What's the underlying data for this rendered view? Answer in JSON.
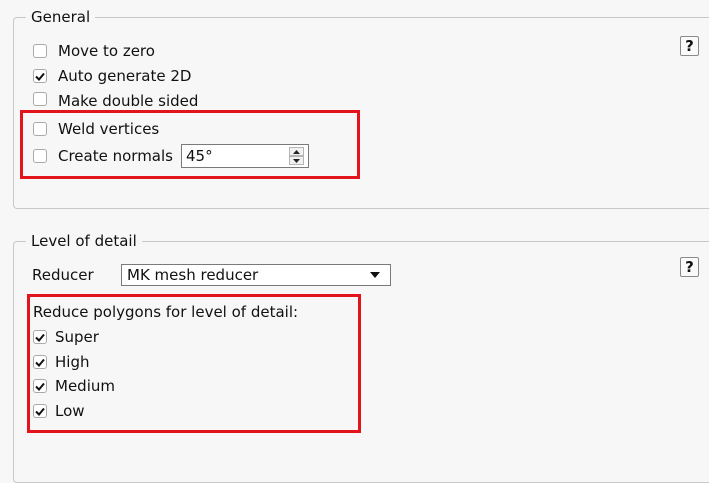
{
  "general": {
    "legend": "General",
    "help": "?",
    "options": [
      {
        "label": "Move to zero",
        "checked": false
      },
      {
        "label": "Auto generate 2D",
        "checked": true
      },
      {
        "label": "Make double sided",
        "checked": false
      },
      {
        "label": "Weld vertices",
        "checked": false
      },
      {
        "label": "Create normals",
        "checked": false
      }
    ],
    "normals_angle": "45°"
  },
  "lod": {
    "legend": "Level of detail",
    "help": "?",
    "reducer_label": "Reducer",
    "reducer_value": "MK mesh reducer",
    "reduce_caption": "Reduce polygons for level of detail:",
    "levels": [
      {
        "label": "Super",
        "checked": true
      },
      {
        "label": "High",
        "checked": true
      },
      {
        "label": "Medium",
        "checked": true
      },
      {
        "label": "Low",
        "checked": true
      }
    ]
  },
  "colors": {
    "highlight": "#e3141b"
  }
}
